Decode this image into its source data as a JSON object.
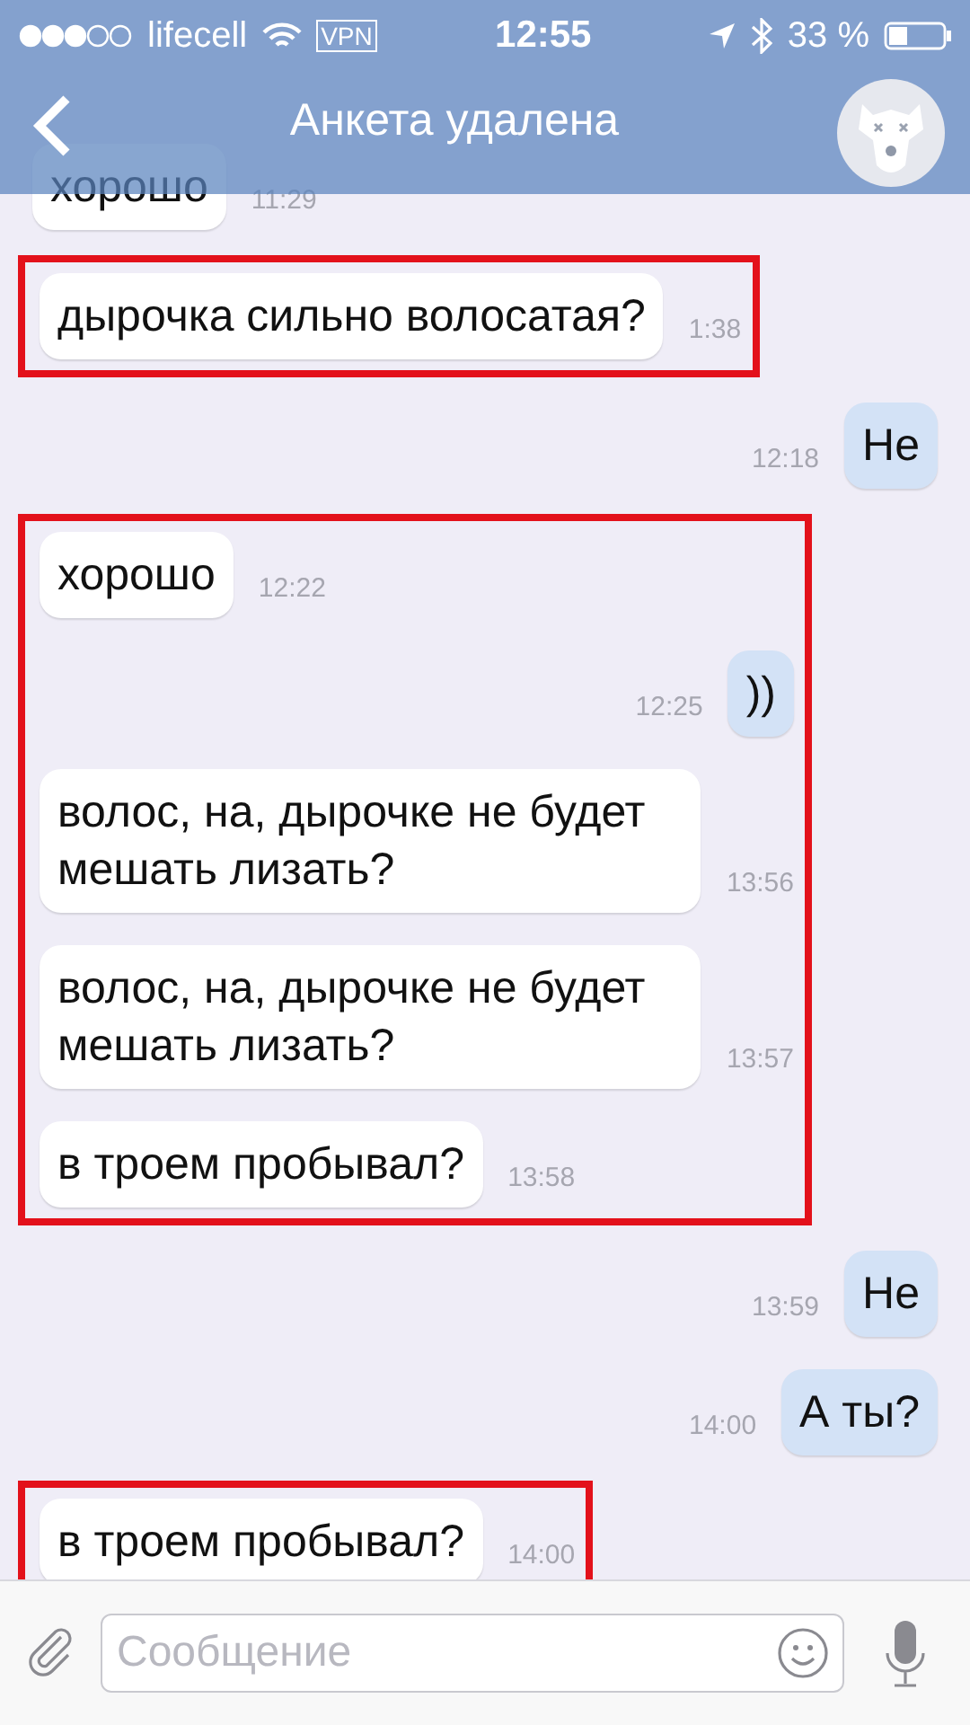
{
  "status_bar": {
    "carrier": "lifecell",
    "vpn": "VPN",
    "time": "12:55",
    "battery": "33 %"
  },
  "header": {
    "title": "Анкета удалена"
  },
  "blocks": [
    {
      "highlighted": false,
      "messages": [
        {
          "outgoing": false,
          "text": "хорошо",
          "time": "11:29"
        }
      ]
    },
    {
      "highlighted": true,
      "messages": [
        {
          "outgoing": false,
          "text": "дырочка сильно волосатая?",
          "time": "1:38"
        }
      ]
    },
    {
      "highlighted": false,
      "messages": [
        {
          "outgoing": true,
          "text": "Не",
          "time": "12:18"
        }
      ]
    },
    {
      "highlighted": true,
      "messages": [
        {
          "outgoing": false,
          "text": "хорошо",
          "time": "12:22"
        },
        {
          "outgoing": true,
          "text": "))",
          "time": "12:25"
        },
        {
          "outgoing": false,
          "text": "волос, на, дырочке не будет мешать лизать?",
          "time": "13:56"
        },
        {
          "outgoing": false,
          "text": "волос, на, дырочке не будет мешать лизать?",
          "time": "13:57"
        },
        {
          "outgoing": false,
          "text": "в троем пробывал?",
          "time": "13:58"
        }
      ]
    },
    {
      "highlighted": false,
      "messages": [
        {
          "outgoing": true,
          "text": "Не",
          "time": "13:59"
        },
        {
          "outgoing": true,
          "text": "А ты?",
          "time": "14:00"
        }
      ]
    },
    {
      "highlighted": true,
      "messages": [
        {
          "outgoing": false,
          "text": "в троем пробывал?",
          "time": "14:00"
        }
      ]
    }
  ],
  "composer": {
    "placeholder": "Сообщение"
  }
}
